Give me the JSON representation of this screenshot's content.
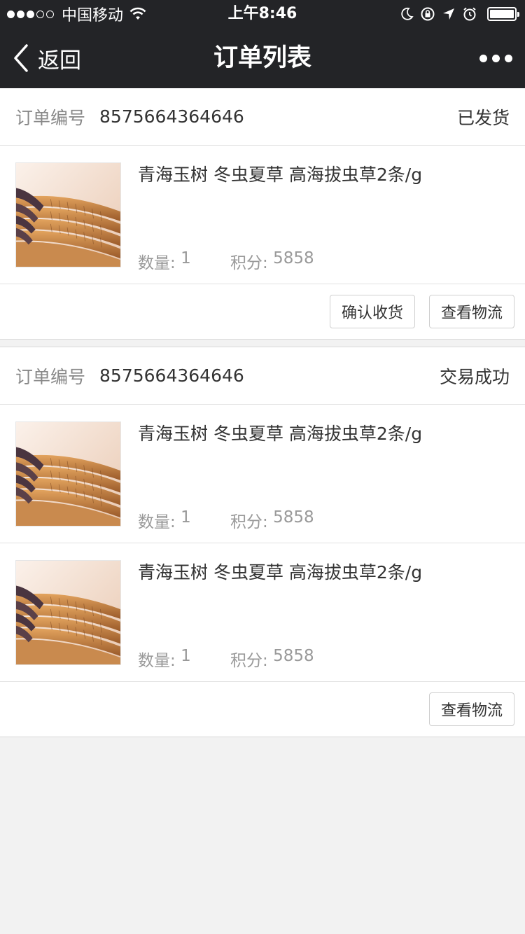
{
  "status_bar": {
    "carrier": "中国移动",
    "time": "上午8:46"
  },
  "nav": {
    "back_label": "返回",
    "title": "订单列表"
  },
  "labels": {
    "order_no": "订单编号",
    "quantity": "数量:",
    "points": "积分:"
  },
  "orders": [
    {
      "order_no": "8575664364646",
      "status": "已发货",
      "items": [
        {
          "name": "青海玉树 冬虫夏草 高海拔虫草2条/g",
          "quantity": "1",
          "points": "5858"
        }
      ],
      "actions": [
        "确认收货",
        "查看物流"
      ]
    },
    {
      "order_no": "8575664364646",
      "status": "交易成功",
      "items": [
        {
          "name": "青海玉树 冬虫夏草 高海拔虫草2条/g",
          "quantity": "1",
          "points": "5858"
        },
        {
          "name": "青海玉树 冬虫夏草 高海拔虫草2条/g",
          "quantity": "1",
          "points": "5858"
        }
      ],
      "actions": [
        "查看物流"
      ]
    }
  ],
  "icons": {
    "back": "chevron-left-icon",
    "more": "more-icon",
    "wifi": "wifi-icon",
    "moon": "moon-icon",
    "lock": "rotation-lock-icon",
    "location": "location-arrow-icon",
    "alarm": "alarm-icon",
    "battery": "battery-icon"
  },
  "colors": {
    "nav_background": "#232427",
    "page_background": "#f2f2f2"
  }
}
